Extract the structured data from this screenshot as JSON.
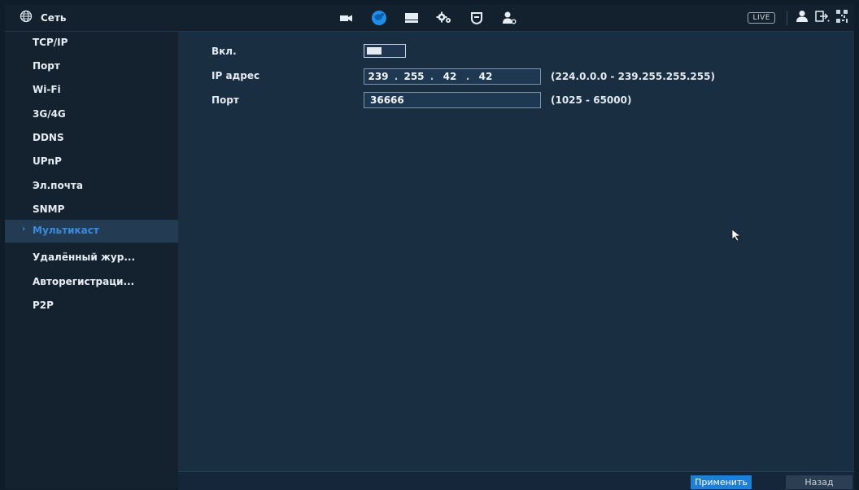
{
  "header": {
    "title": "Сеть",
    "title_icon": "globe-icon",
    "nav_icons": [
      "camera-icon",
      "network-icon",
      "storage-icon",
      "system-settings-icon",
      "security-shield-icon",
      "account-icon"
    ],
    "active_nav": "network-icon",
    "live_label": "LIVE",
    "right_icons": [
      "user-icon",
      "logout-icon",
      "qr-code-icon"
    ]
  },
  "sidebar": {
    "items": [
      {
        "label": "TCP/IP"
      },
      {
        "label": "Порт"
      },
      {
        "label": "Wi-Fi"
      },
      {
        "label": "3G/4G"
      },
      {
        "label": "DDNS"
      },
      {
        "label": "UPnP"
      },
      {
        "label": "Эл.почта"
      },
      {
        "label": "SNMP"
      },
      {
        "label": "Мультикаст",
        "active": true
      },
      {
        "label": "Удалённый жур..."
      },
      {
        "label": "Авторегистраци..."
      },
      {
        "label": "P2P"
      }
    ]
  },
  "form": {
    "enable_label": "Вкл.",
    "enabled": true,
    "ip_label": "IP адрес",
    "ip_octets": [
      "239",
      "255",
      "42",
      "42"
    ],
    "ip_range_hint": "(224.0.0.0 - 239.255.255.255)",
    "port_label": "Порт",
    "port_value": "36666",
    "port_range_hint": "(1025 - 65000)"
  },
  "footer": {
    "apply_label": "Применить",
    "back_label": "Назад"
  },
  "colors": {
    "accent": "#1d7fd6",
    "active_text": "#3d8ad9",
    "background": "#1a2e42",
    "sidebar": "#142230"
  }
}
